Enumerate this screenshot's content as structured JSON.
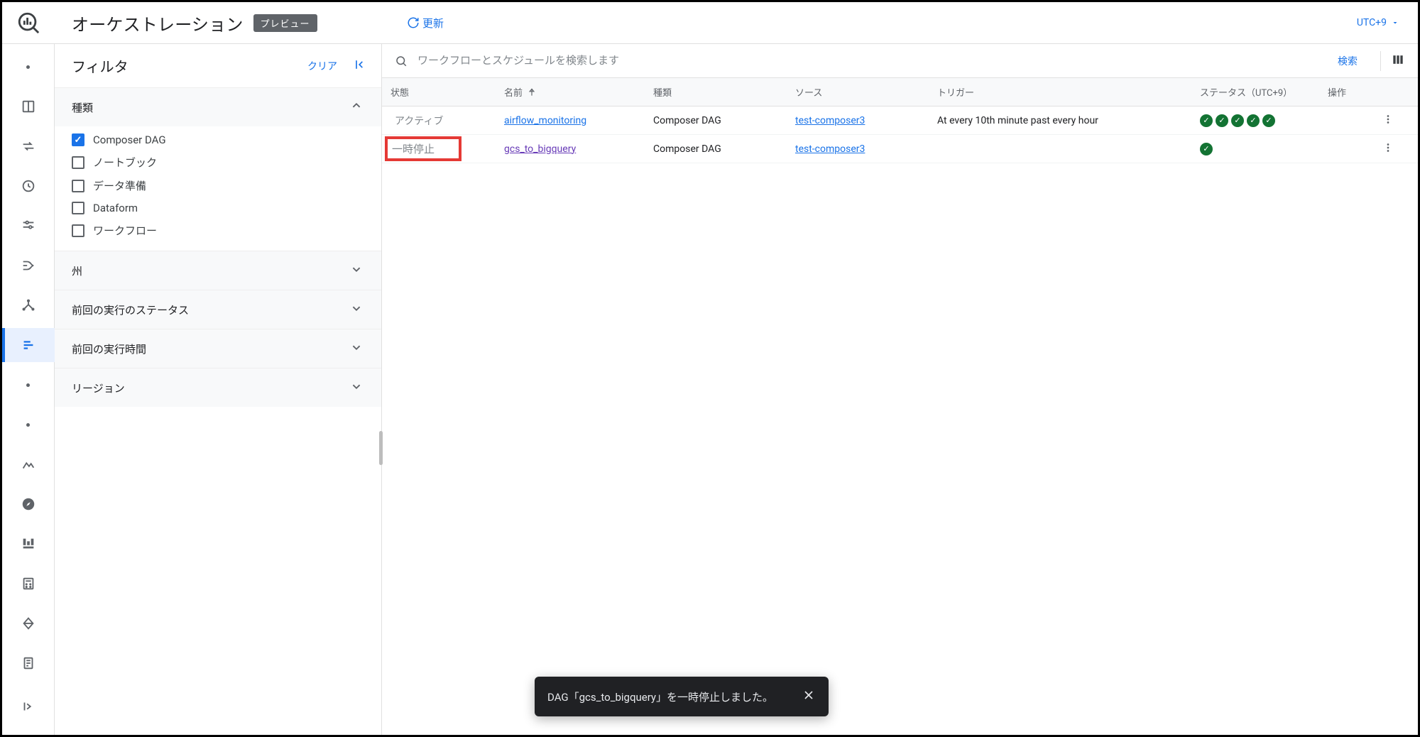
{
  "header": {
    "title": "オーケストレーション",
    "preview_badge": "プレビュー",
    "refresh_label": "更新",
    "timezone_label": "UTC+9"
  },
  "filter": {
    "title": "フィルタ",
    "clear_label": "クリア",
    "sections": {
      "type": {
        "title": "種類"
      },
      "state": {
        "title": "州"
      },
      "last_status": {
        "title": "前回の実行のステータス"
      },
      "last_time": {
        "title": "前回の実行時間"
      },
      "region": {
        "title": "リージョン"
      }
    },
    "type_options": [
      {
        "label": "Composer DAG",
        "checked": true
      },
      {
        "label": "ノートブック",
        "checked": false
      },
      {
        "label": "データ準備",
        "checked": false
      },
      {
        "label": "Dataform",
        "checked": false
      },
      {
        "label": "ワークフロー",
        "checked": false
      }
    ]
  },
  "search": {
    "placeholder": "ワークフローとスケジュールを検索します",
    "button_label": "検索"
  },
  "table": {
    "headers": {
      "state": "状態",
      "name": "名前",
      "type": "種類",
      "source": "ソース",
      "trigger": "トリガー",
      "status": "ステータス（UTC+9）",
      "actions": "操作"
    },
    "rows": [
      {
        "state": "アクティブ",
        "name": "airflow_monitoring",
        "name_visited": false,
        "type": "Composer DAG",
        "source": "test-composer3",
        "trigger": "At every 10th minute past every hour",
        "status_count": 5,
        "highlight": false
      },
      {
        "state": "一時停止",
        "name": "gcs_to_bigquery",
        "name_visited": true,
        "type": "Composer DAG",
        "source": "test-composer3",
        "trigger": "",
        "status_count": 1,
        "highlight": true
      }
    ]
  },
  "toast": {
    "message": "DAG「gcs_to_bigquery」を一時停止しました。"
  }
}
